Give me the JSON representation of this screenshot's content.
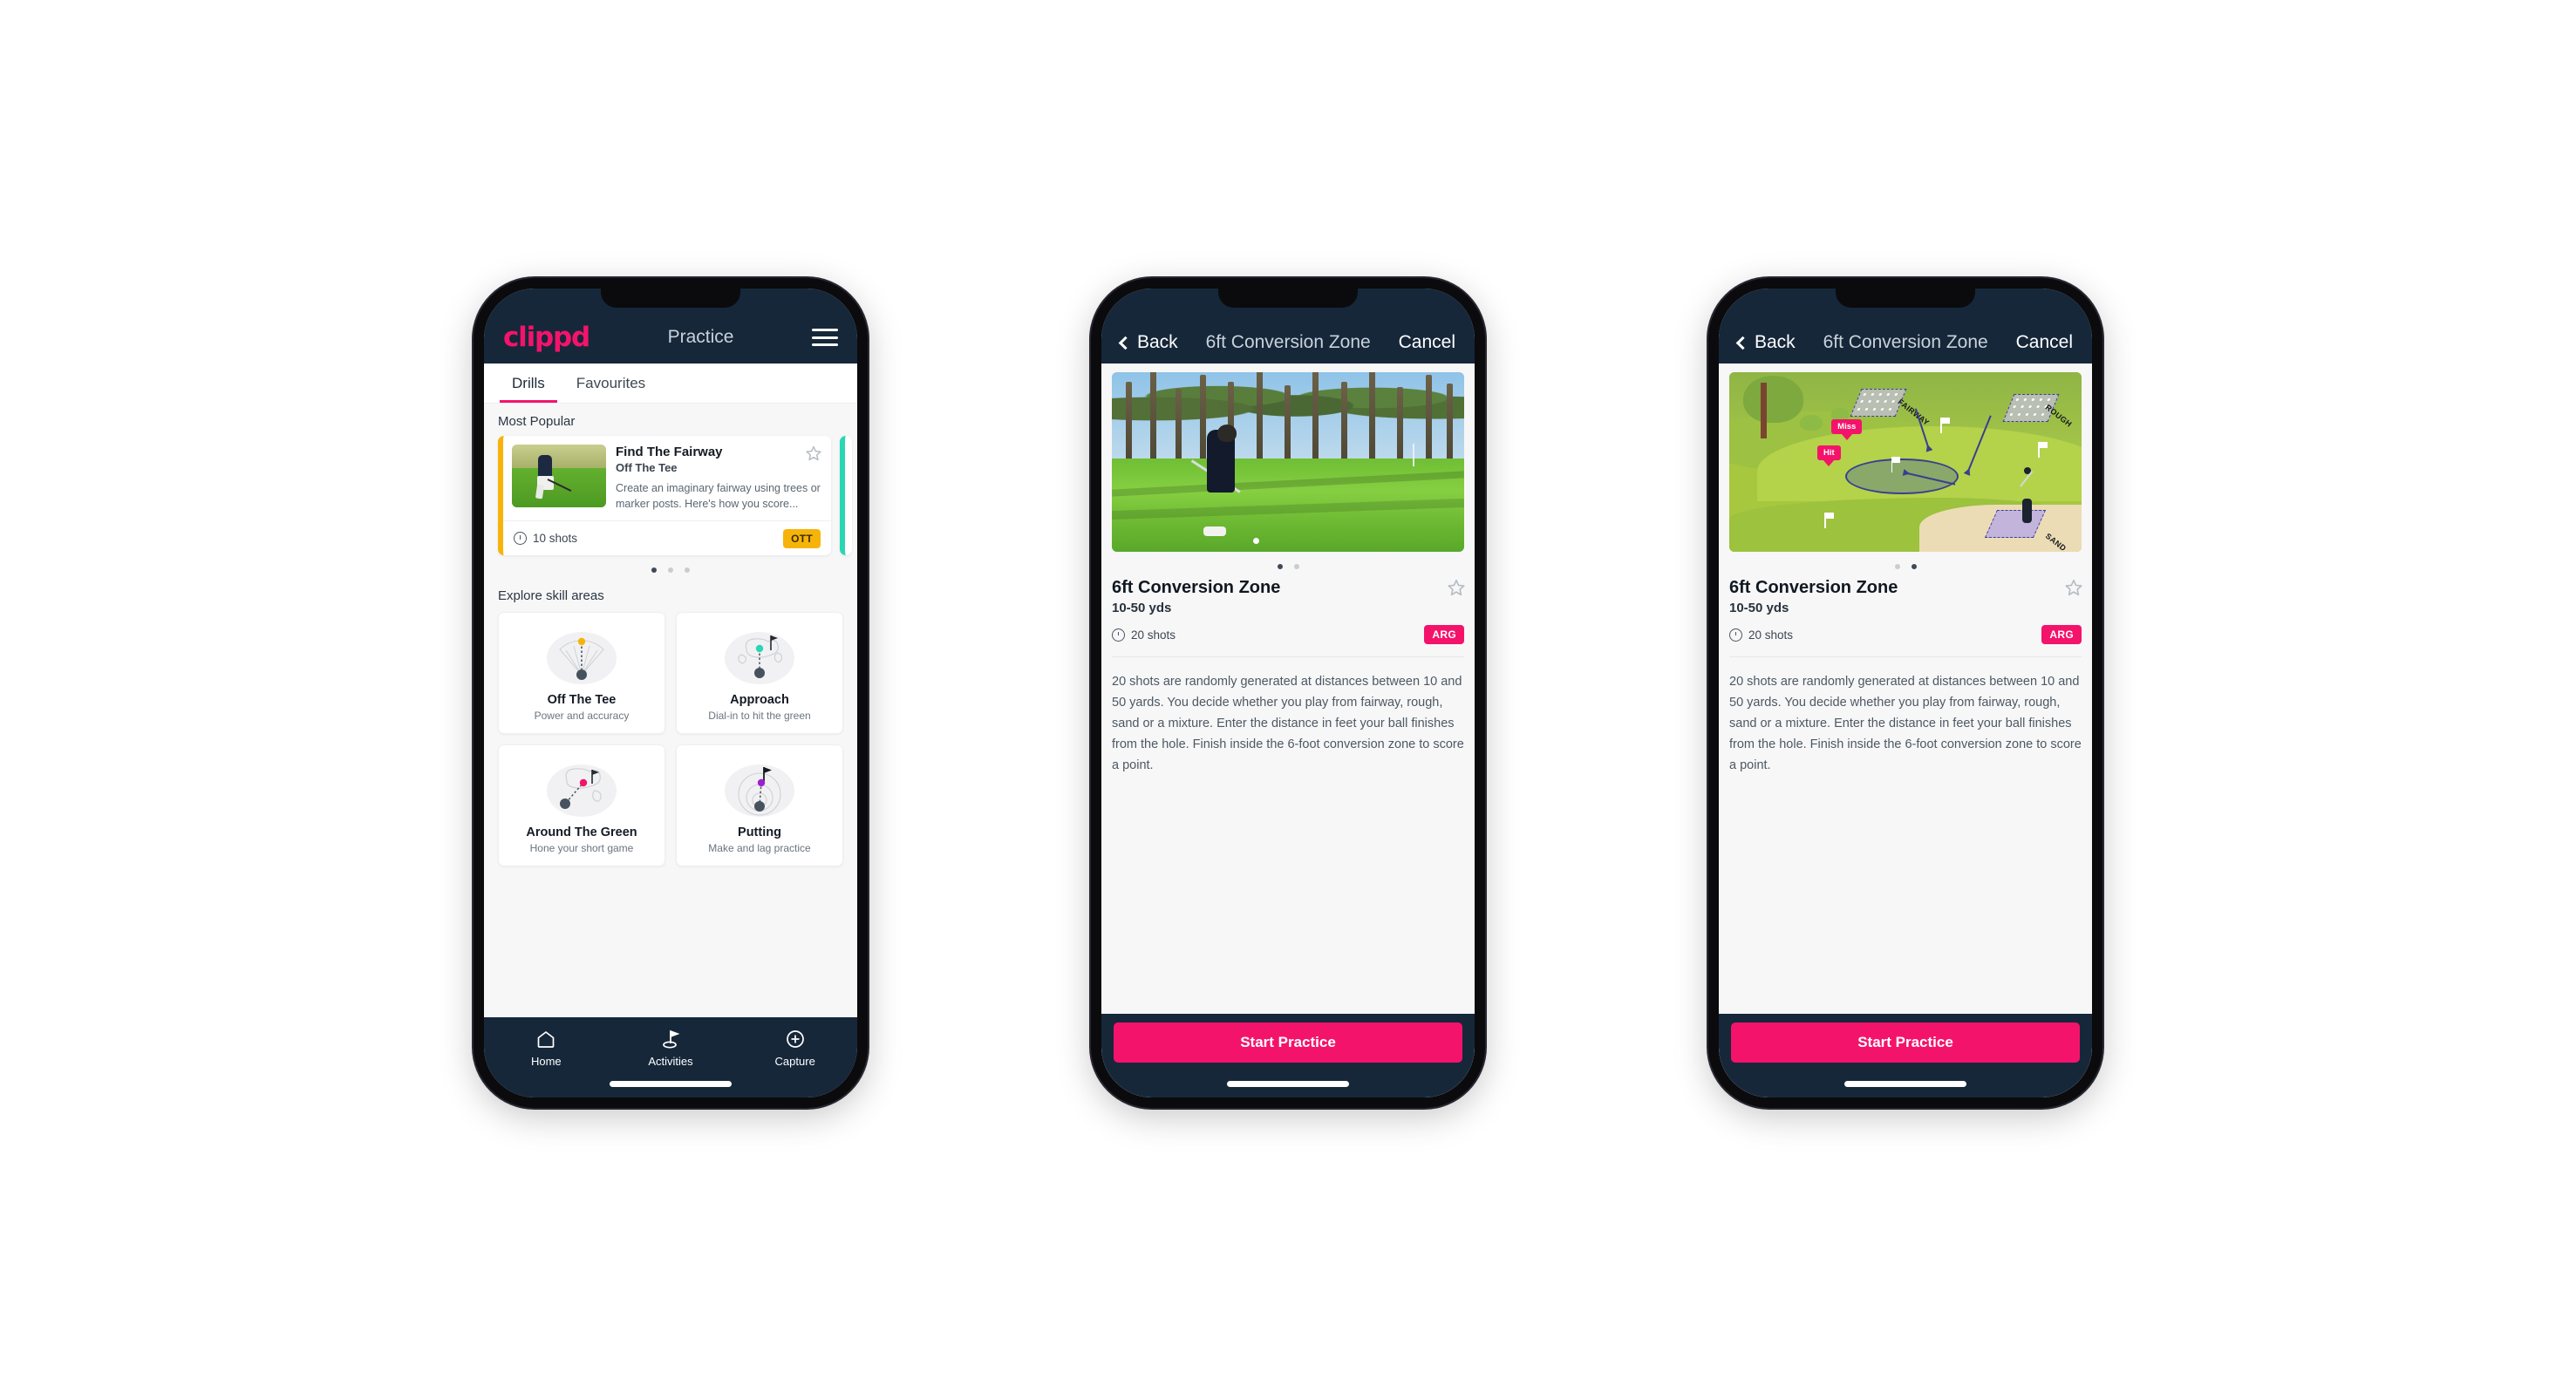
{
  "phone1": {
    "header": {
      "logo": "clippd",
      "title": "Practice",
      "menu_icon": "hamburger-menu-icon"
    },
    "tabs": [
      {
        "label": "Drills",
        "active": true
      },
      {
        "label": "Favourites",
        "active": false
      }
    ],
    "sections": {
      "most_popular_label": "Most Popular",
      "explore_label": "Explore skill areas"
    },
    "drill_card": {
      "title": "Find The Fairway",
      "subtitle": "Off The Tee",
      "description": "Create an imaginary fairway using trees or marker posts. Here's how you score...",
      "shots": "10 shots",
      "badge": "OTT",
      "badge_color": "#f6b40a",
      "star_icon": "star-outline-icon",
      "clock_icon": "clock-icon"
    },
    "carousel_dots": 3,
    "carousel_active": 0,
    "skills": [
      {
        "name": "Off The Tee",
        "desc": "Power and accuracy",
        "icon": "tee-fan-icon",
        "accent": "#f6b40a"
      },
      {
        "name": "Approach",
        "desc": "Dial-in to hit the green",
        "icon": "approach-green-icon",
        "accent": "#2ad6b4"
      },
      {
        "name": "Around The Green",
        "desc": "Hone your short game",
        "icon": "around-green-icon",
        "accent": "#f4136b"
      },
      {
        "name": "Putting",
        "desc": "Make and lag practice",
        "icon": "putting-rings-icon",
        "accent": "#a020d0"
      }
    ],
    "bottom_nav": [
      {
        "label": "Home",
        "icon": "home-icon",
        "active": false
      },
      {
        "label": "Activities",
        "icon": "golf-flag-icon",
        "active": true
      },
      {
        "label": "Capture",
        "icon": "plus-circle-icon",
        "active": false
      }
    ]
  },
  "phone2": {
    "header": {
      "back": "Back",
      "title": "6ft Conversion Zone",
      "cancel": "Cancel",
      "back_icon": "chevron-left-icon"
    },
    "media": {
      "type": "photo",
      "alt": "golfer-chipping-photo"
    },
    "carousel_dots": 2,
    "carousel_active": 0,
    "detail": {
      "title": "6ft Conversion Zone",
      "range": "10-50 yds",
      "shots": "20 shots",
      "badge": "ARG",
      "badge_color": "#f4136b",
      "star_icon": "star-outline-icon",
      "clock_icon": "clock-icon",
      "description": "20 shots are randomly generated at distances between 10 and 50 yards. You decide whether you play from fairway, rough, sand or a mixture. Enter the distance in feet your ball finishes from the hole. Finish inside the 6-foot conversion zone to score a point."
    },
    "cta": "Start Practice"
  },
  "phone3": {
    "header": {
      "back": "Back",
      "title": "6ft Conversion Zone",
      "cancel": "Cancel",
      "back_icon": "chevron-left-icon"
    },
    "media": {
      "type": "illustration",
      "alt": "golf-course-diagram",
      "labels": [
        "FAIRWAY",
        "ROUGH",
        "SAND"
      ],
      "tags": [
        "Miss",
        "Hit"
      ]
    },
    "carousel_dots": 2,
    "carousel_active": 1,
    "detail": {
      "title": "6ft Conversion Zone",
      "range": "10-50 yds",
      "shots": "20 shots",
      "badge": "ARG",
      "badge_color": "#f4136b",
      "star_icon": "star-outline-icon",
      "clock_icon": "clock-icon",
      "description": "20 shots are randomly generated at distances between 10 and 50 yards. You decide whether you play from fairway, rough, sand or a mixture. Enter the distance in feet your ball finishes from the hole. Finish inside the 6-foot conversion zone to score a point."
    },
    "cta": "Start Practice"
  },
  "theme": {
    "brand_pink": "#f4136b",
    "header_navy": "#16273a",
    "amber": "#f6b40a",
    "teal": "#2ad6b4",
    "page_bg": "#f7f7f8"
  }
}
